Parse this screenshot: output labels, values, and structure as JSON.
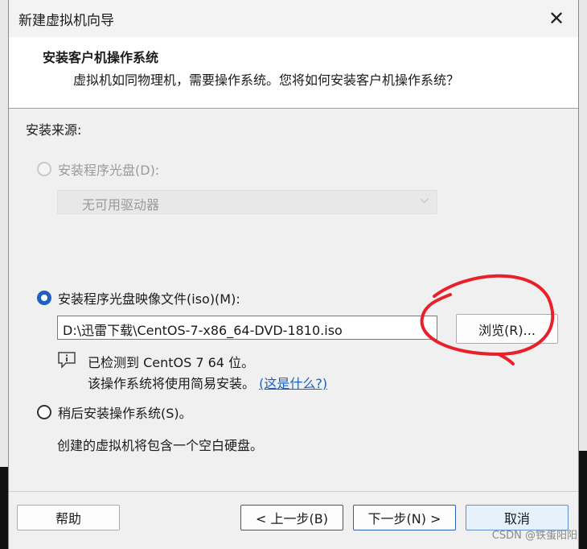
{
  "window": {
    "title": "新建虚拟机向导",
    "close_glyph": "✕"
  },
  "header": {
    "title": "安装客户机操作系统",
    "subtitle": "虚拟机如同物理机，需要操作系统。您将如何安装客户机操作系统？"
  },
  "source": {
    "label": "安装来源:",
    "disc_option": {
      "label": "安装程序光盘(D):",
      "state": "disabled"
    },
    "drive_select": {
      "value": "无可用驱动器",
      "chevron": "⌵"
    },
    "iso_option": {
      "label": "安装程序光盘映像文件(iso)(M):",
      "state": "checked"
    },
    "iso_path": "D:\\迅雷下载\\CentOS-7-x86_64-DVD-1810.iso",
    "browse_label": "浏览(R)...",
    "detected_text": "已检测到 CentOS 7 64 位。",
    "easy_install_text": "该操作系统将使用简易安装。",
    "what_link": "(这是什么?)",
    "later_option": {
      "label": "稍后安装操作系统(S)。",
      "state": "unchecked"
    },
    "later_desc": "创建的虚拟机将包含一个空白硬盘。"
  },
  "footer": {
    "help": "帮助",
    "back": "< 上一步(B)",
    "next": "下一步(N) >",
    "cancel": "取消"
  },
  "watermark": "CSDN @铁蛋阳阳",
  "colors": {
    "accent": "#1f5fbf",
    "annotation": "#e8202a"
  }
}
